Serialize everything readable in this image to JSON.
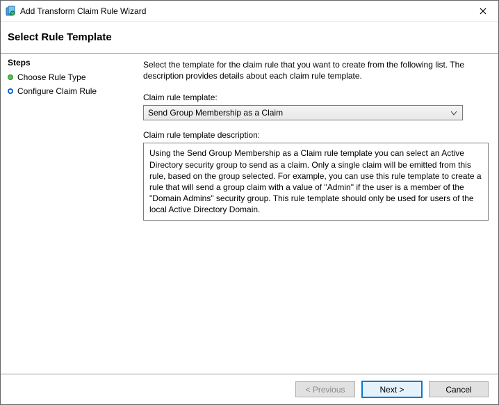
{
  "window": {
    "title": "Add Transform Claim Rule Wizard"
  },
  "header": {
    "heading": "Select Rule Template"
  },
  "sidebar": {
    "title": "Steps",
    "items": [
      {
        "label": "Choose Rule Type",
        "state": "done"
      },
      {
        "label": "Configure Claim Rule",
        "state": "current"
      }
    ]
  },
  "main": {
    "intro": "Select the template for the claim rule that you want to create from the following list. The description provides details about each claim rule template.",
    "template_label": "Claim rule template:",
    "template_value": "Send Group Membership as a Claim",
    "desc_label": "Claim rule template description:",
    "desc_text": "Using the Send Group Membership as a Claim rule template you can select an Active Directory security group to send as a claim. Only a single claim will be emitted from this rule, based on the group selected. For example, you can use this rule template to create a rule that will send a group claim with a value of \"Admin\" if the user is a member of the \"Domain Admins\" security group.  This rule template should only be used for users of the local Active Directory Domain."
  },
  "footer": {
    "previous": "< Previous",
    "next": "Next >",
    "cancel": "Cancel"
  }
}
